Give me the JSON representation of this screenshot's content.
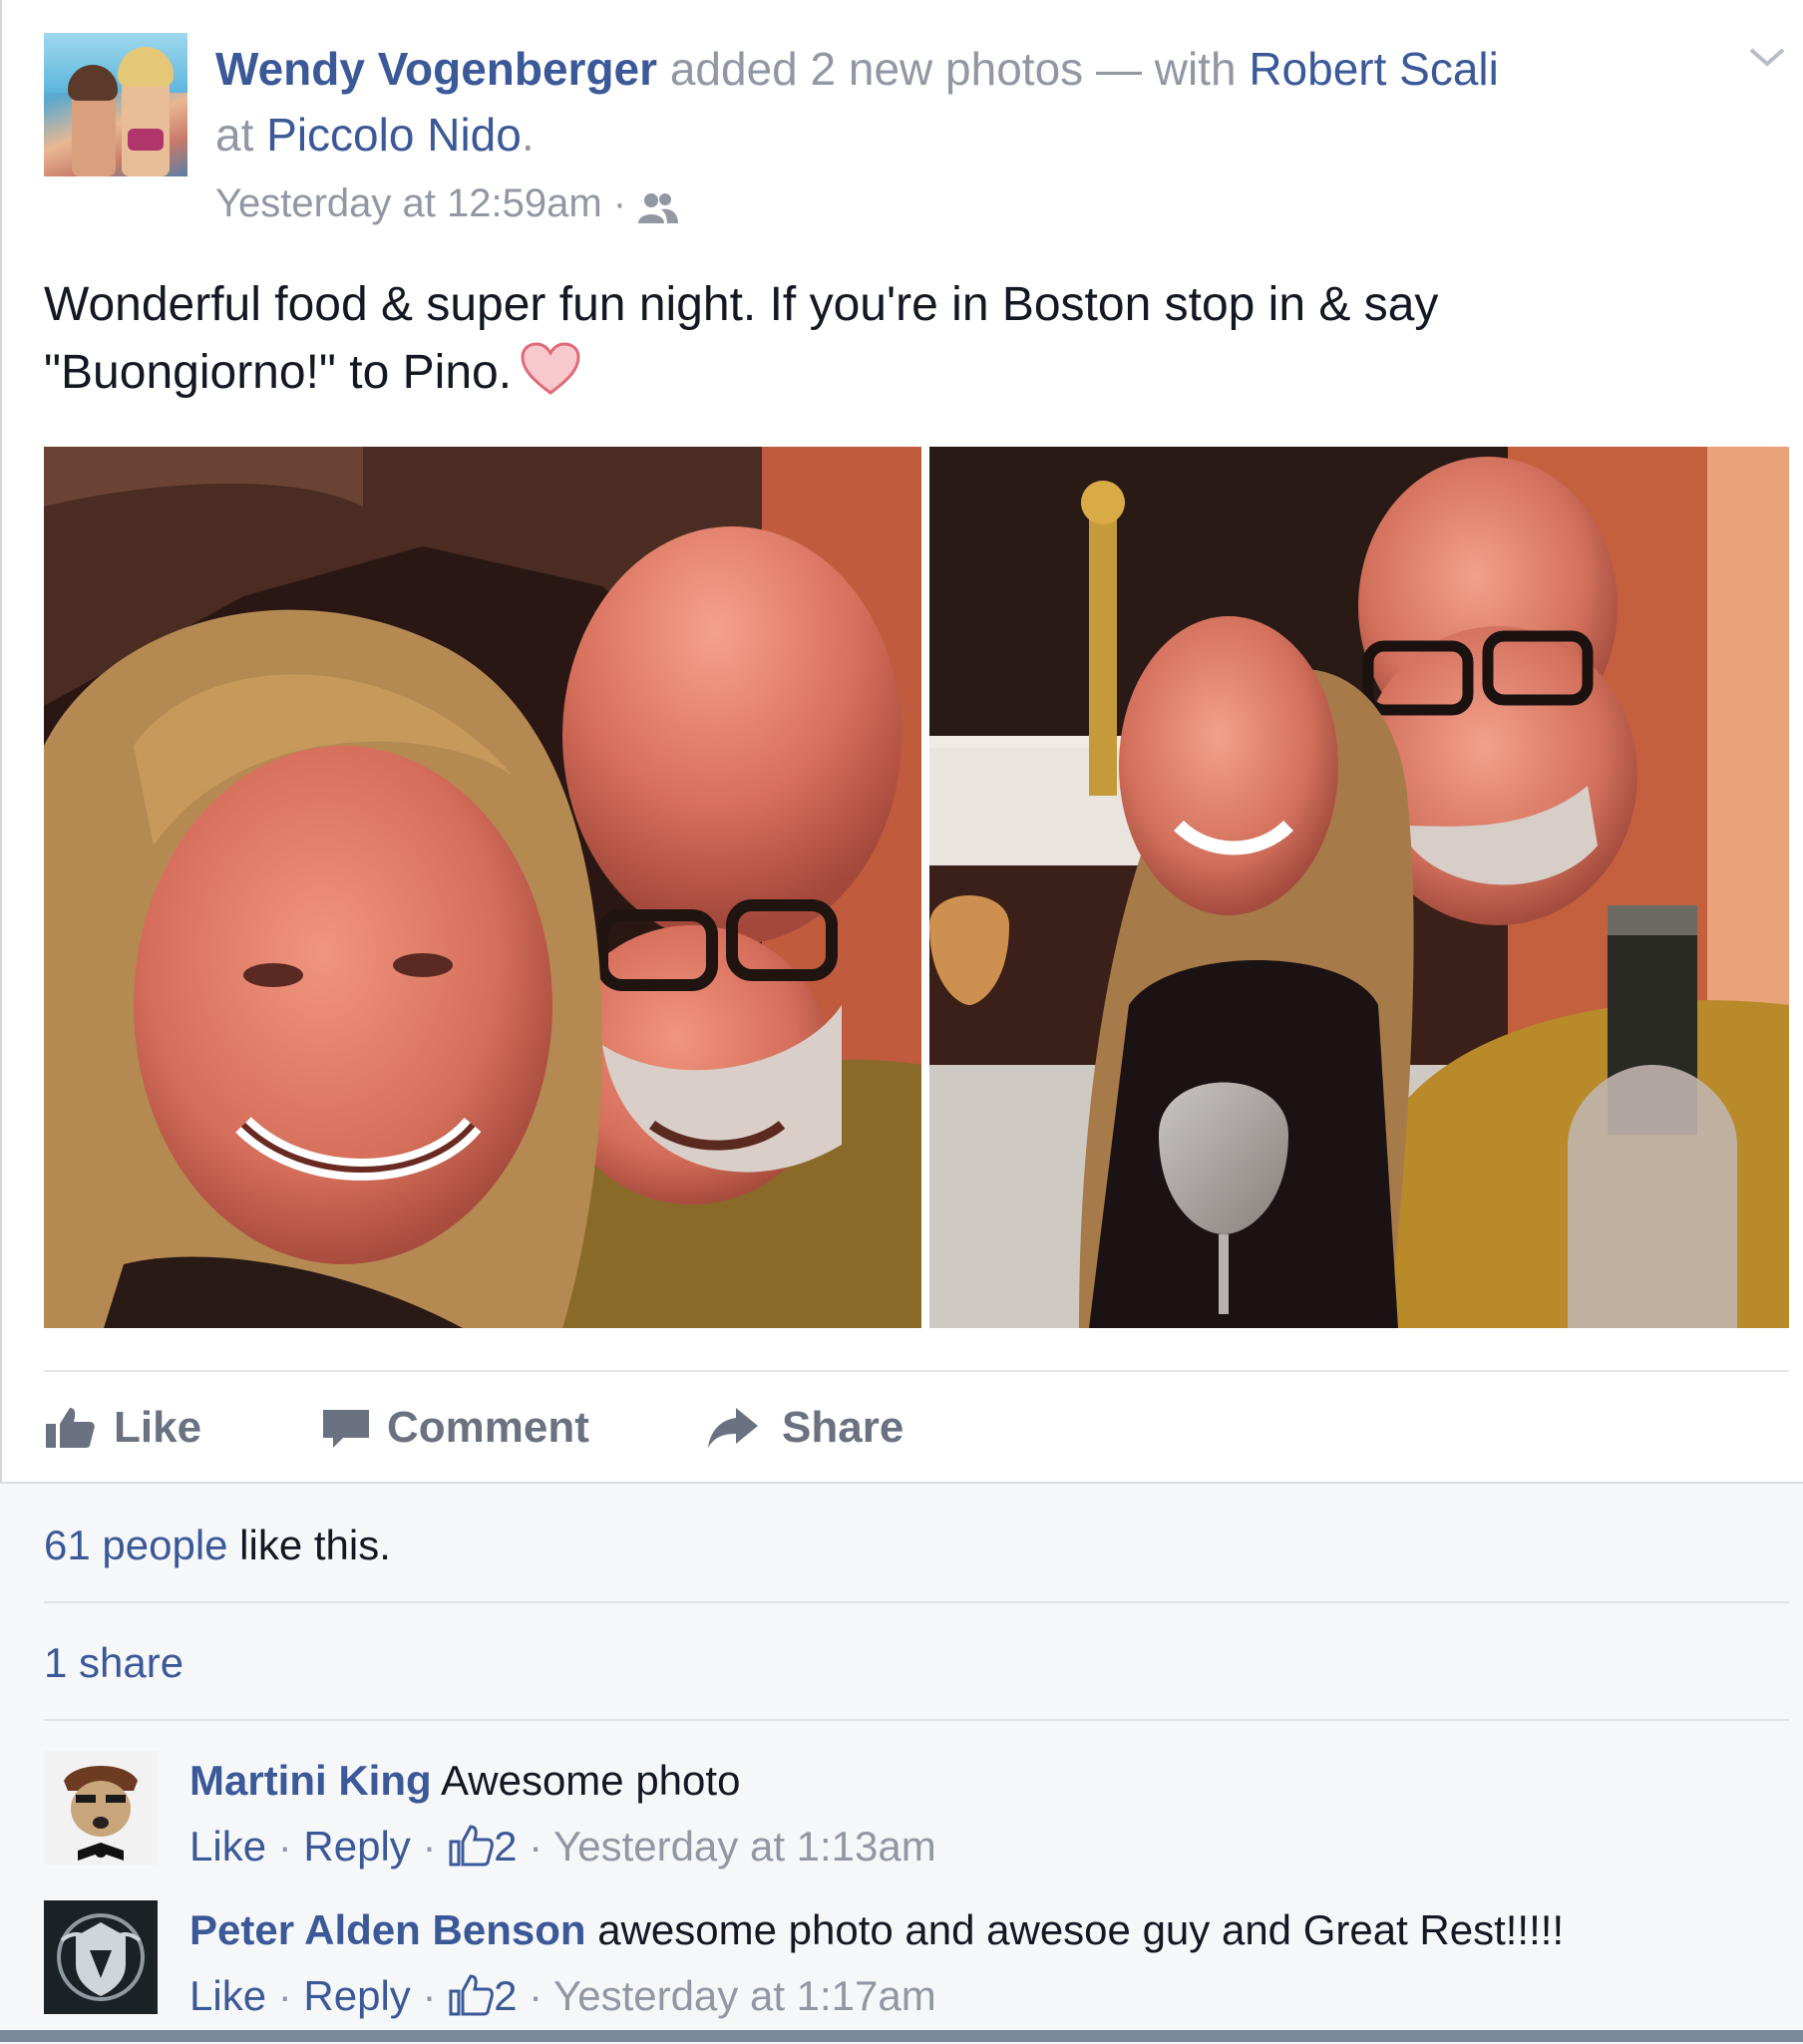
{
  "post": {
    "author": "Wendy Vogenberger",
    "action_text": " added 2 new photos — with ",
    "tagged": "Robert Scali",
    "location_prefix": "at ",
    "location": "Piccolo Nido",
    "location_suffix": ".",
    "timestamp": "Yesterday at 12:59am",
    "meta_separator": " · ",
    "audience_icon": "friends-icon",
    "message_line1": "Wonderful food & super fun night. If you're in Boston stop in & say",
    "message_line2": "\"Buongiorno!\" to Pino.",
    "emoji": "heart-icon"
  },
  "actions": {
    "like": "Like",
    "comment": "Comment",
    "share": "Share"
  },
  "stats": {
    "likes_count": "61 people",
    "likes_suffix": " like this.",
    "shares": "1 share"
  },
  "comments": [
    {
      "author": "Martini King",
      "text": " Awesome photo",
      "like": "Like",
      "reply": "Reply",
      "likes": "2",
      "separator": " · ",
      "time": "Yesterday at 1:13am"
    },
    {
      "author": "Peter Alden Benson",
      "text": " awesome photo and awesoe guy and Great Rest!!!!!",
      "like": "Like",
      "reply": "Reply",
      "likes": "2",
      "separator": " · ",
      "time": "Yesterday at 1:17am"
    }
  ],
  "colors": {
    "link": "#3b5998",
    "secondary_text": "#9197a3",
    "action_text": "#6a7180",
    "ufi_background": "#f6f7f9"
  }
}
